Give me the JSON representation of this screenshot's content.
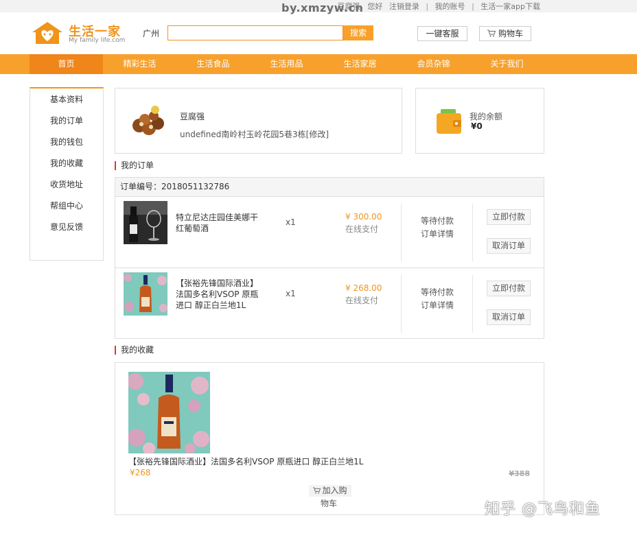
{
  "topbar": {
    "watermark": "by.xmzyw.cn",
    "greeting": "豆腐强，您好",
    "logout": "注销登录",
    "account": "我的账号",
    "app_download": "生活一家app下载"
  },
  "header": {
    "logo_title": "生活一家",
    "logo_sub": "My family life.com",
    "city": "广州",
    "search_placeholder": "",
    "search_label": "搜索",
    "kefu_label": "一键客服",
    "cart_label": "购物车"
  },
  "nav": {
    "items": [
      "首页",
      "精彩生活",
      "生活食品",
      "生活用品",
      "生活家居",
      "会员杂锦",
      "关于我们"
    ],
    "active": "首页"
  },
  "sidebar": {
    "items": [
      "基本资料",
      "我的订单",
      "我的钱包",
      "我的收藏",
      "收货地址",
      "帮组中心",
      "意见反馈"
    ]
  },
  "profile": {
    "name": "豆腐强",
    "address": "undefined南岭村玉岭花园5巷3栋[修改]"
  },
  "balance": {
    "label": "我的余额",
    "value": "¥0"
  },
  "orders": {
    "title": "我的订单",
    "order_no_label": "订单编号：",
    "order_no": "2018051132786",
    "items": [
      {
        "name": "特立尼达庄园佳美娜干红葡萄酒",
        "qty": "x1",
        "price": "¥ 300.00",
        "pay_type": "在线支付",
        "status": "等待付款",
        "detail": "订单详情",
        "pay_btn": "立即付款",
        "cancel_btn": "取消订单"
      },
      {
        "name": "【张裕先锋国际酒业】法国多名利VSOP 原瓶进口 醇正白兰地1L",
        "qty": "x1",
        "price": "¥ 268.00",
        "pay_type": "在线支付",
        "status": "等待付款",
        "detail": "订单详情",
        "pay_btn": "立即付款",
        "cancel_btn": "取消订单"
      }
    ]
  },
  "favorites": {
    "title": "我的收藏",
    "item": {
      "name": "【张裕先锋国际酒业】法国多名利VSOP 原瓶进口 醇正白兰地1L",
      "price": "¥268",
      "old_price": "¥388",
      "add_cart_1": "加入购",
      "add_cart_2": "物车"
    }
  },
  "overlay_watermark": "知乎 @飞鸟和鱼",
  "colors": {
    "accent": "#f7a12c",
    "nav_active": "#f0851a",
    "price": "#f0941c",
    "section_mark": "#e0342b"
  }
}
